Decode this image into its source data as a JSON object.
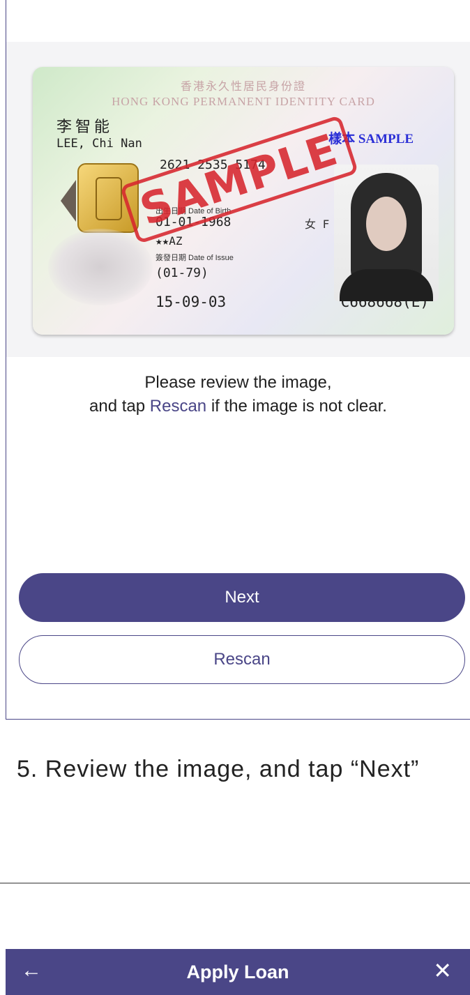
{
  "card": {
    "header_cn": "香港永久性居民身份證",
    "header_en": "HONG KONG PERMANENT IDENTITY CARD",
    "name_cn": "李智能",
    "name_en": "LEE, Chi Nan",
    "sample_tag": "樣本 SAMPLE",
    "number": "2621 2535 5174",
    "dob_label": "出生日期 Date of Birth",
    "dob": "01-01-1968",
    "sex": "女 F",
    "symbol": "★★AZ",
    "issue_label": "簽發日期 Date of Issue",
    "first_issue": "(01-79)",
    "issue_date": "15-09-03",
    "card_no": "C668668(E)",
    "stamp": "SAMPLE"
  },
  "instruction": {
    "line1": "Please review the image,",
    "pre": "and tap ",
    "link": "Rescan",
    "post": " if the image is not clear."
  },
  "buttons": {
    "next": "Next",
    "rescan": "Rescan"
  },
  "caption": "5. Review the image, and tap “Next”",
  "appbar": {
    "back_icon": "←",
    "title": "Apply Loan",
    "close_icon": "✕"
  },
  "colors": {
    "brand": "#4a4687",
    "stamp": "#d7262e"
  }
}
